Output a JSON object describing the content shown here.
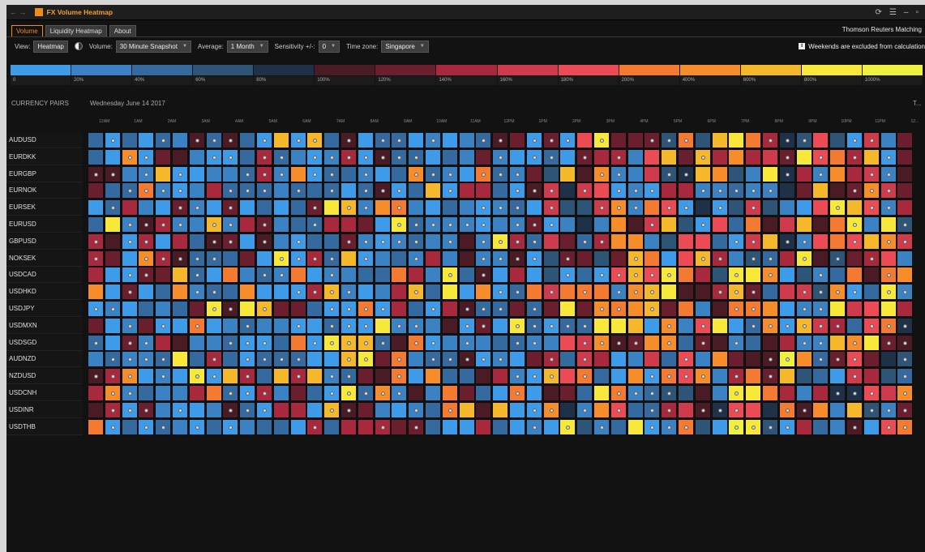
{
  "titlebar": {
    "title": "FX Volume Heatmap",
    "nav_arrows": "← →",
    "icons": [
      "refresh-icon",
      "menu-icon",
      "minimize-icon",
      "restore-icon"
    ]
  },
  "tabs": [
    {
      "label": "Volume",
      "active": true
    },
    {
      "label": "Liquidity Heatmap",
      "active": false
    },
    {
      "label": "About",
      "active": false
    }
  ],
  "provider": "Thomson Reuters Matching",
  "controls": {
    "view_label": "View:",
    "view_value": "Heatmap",
    "volume_label": "Volume:",
    "volume_value": "30 Minute Snapshot",
    "average_label": "Average:",
    "average_value": "1 Month",
    "sensitivity_label": "Sensitivity +/-:",
    "sensitivity_value": "0",
    "timezone_label": "Time zone:",
    "timezone_value": "Singapore",
    "note": "Weekends are excluded from calculation"
  },
  "legend": [
    {
      "label": "0",
      "color": "#3d9be9"
    },
    {
      "label": "20%",
      "color": "#3b82c4"
    },
    {
      "label": "40%",
      "color": "#356aa0"
    },
    {
      "label": "60%",
      "color": "#2e5478"
    },
    {
      "label": "80%",
      "color": "#1f3148"
    },
    {
      "label": "100%",
      "color": "#4a1a25"
    },
    {
      "label": "120%",
      "color": "#6b1e2e"
    },
    {
      "label": "140%",
      "color": "#a8283d"
    },
    {
      "label": "160%",
      "color": "#cf3a4c"
    },
    {
      "label": "180%",
      "color": "#ec4a55"
    },
    {
      "label": "200%",
      "color": "#f47a32"
    },
    {
      "label": "400%",
      "color": "#f68d2a"
    },
    {
      "label": "600%",
      "color": "#f4b82a"
    },
    {
      "label": "800%",
      "color": "#f8e83a"
    },
    {
      "label": "1000%",
      "color": "#f0f040"
    }
  ],
  "grid": {
    "pairs_header": "CURRENCY PAIRS",
    "date": "Wednesday June 14 2017",
    "next_date": "T...",
    "hours": [
      "12AM",
      "1AM",
      "2AM",
      "3AM",
      "4AM",
      "5AM",
      "6AM",
      "7AM",
      "8AM",
      "9AM",
      "10AM",
      "11AM",
      "12PM",
      "1PM",
      "2PM",
      "3PM",
      "4PM",
      "5PM",
      "6PM",
      "7PM",
      "8PM",
      "9PM",
      "10PM",
      "11PM"
    ],
    "next_hour": "12...",
    "pairs": [
      "AUDUSD",
      "EURDKK",
      "EURGBP",
      "EURNOK",
      "EURSEK",
      "EURUSD",
      "GBPUSD",
      "NOKSEK",
      "USDCAD",
      "USDHKD",
      "USDJPY",
      "USDMXN",
      "USDSGD",
      "AUDNZD",
      "NZDUSD",
      "USDCNH",
      "USDINR",
      "USDTHB"
    ]
  }
}
